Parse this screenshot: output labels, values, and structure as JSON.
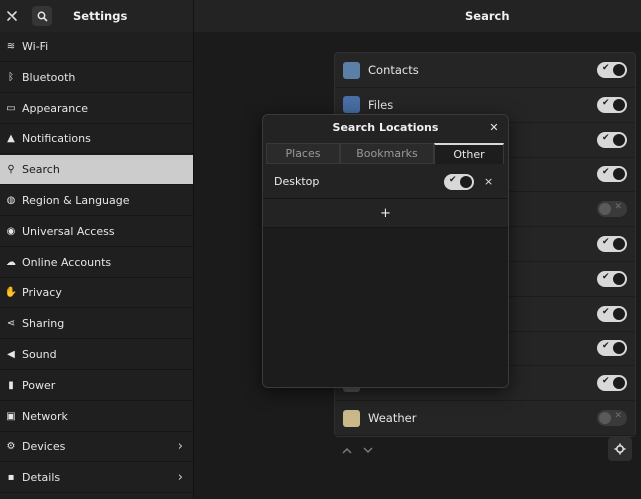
{
  "header": {
    "sidebar_title": "Settings",
    "main_title": "Search",
    "tools_icon": "tools-icon",
    "search_icon": "search-icon"
  },
  "sidebar": {
    "items": [
      {
        "label": "Wi-Fi",
        "icon": "wifi-icon",
        "glyph": "≋",
        "active": false,
        "chevron": ""
      },
      {
        "label": "Bluetooth",
        "icon": "bluetooth-icon",
        "glyph": "ᛒ",
        "active": false,
        "chevron": ""
      },
      {
        "label": "Appearance",
        "icon": "appearance-icon",
        "glyph": "▭",
        "active": false,
        "chevron": ""
      },
      {
        "label": "Notifications",
        "icon": "bell-icon",
        "glyph": "▲",
        "active": false,
        "chevron": ""
      },
      {
        "label": "Search",
        "icon": "search-icon",
        "glyph": "⚲",
        "active": true,
        "chevron": ""
      },
      {
        "label": "Region & Language",
        "icon": "globe-icon",
        "glyph": "◍",
        "active": false,
        "chevron": ""
      },
      {
        "label": "Universal Access",
        "icon": "accessibility-icon",
        "glyph": "◉",
        "active": false,
        "chevron": ""
      },
      {
        "label": "Online Accounts",
        "icon": "cloud-icon",
        "glyph": "☁",
        "active": false,
        "chevron": ""
      },
      {
        "label": "Privacy",
        "icon": "hand-icon",
        "glyph": "✋",
        "active": false,
        "chevron": ""
      },
      {
        "label": "Sharing",
        "icon": "share-icon",
        "glyph": "⋖",
        "active": false,
        "chevron": ""
      },
      {
        "label": "Sound",
        "icon": "speaker-icon",
        "glyph": "◀",
        "active": false,
        "chevron": ""
      },
      {
        "label": "Power",
        "icon": "power-icon",
        "glyph": "▮",
        "active": false,
        "chevron": ""
      },
      {
        "label": "Network",
        "icon": "network-icon",
        "glyph": "▣",
        "active": false,
        "chevron": ""
      },
      {
        "label": "Devices",
        "icon": "devices-icon",
        "glyph": "⚙",
        "active": false,
        "chevron": "›"
      },
      {
        "label": "Details",
        "icon": "info-icon",
        "glyph": "▪",
        "active": false,
        "chevron": "›"
      }
    ]
  },
  "search_list": {
    "items": [
      {
        "name": "Contacts",
        "icon": "contacts-icon",
        "color": "#5b7fa6",
        "enabled": true
      },
      {
        "name": "Files",
        "icon": "files-icon",
        "color": "#4a6fa5",
        "enabled": true
      },
      {
        "name": "",
        "icon": "app-icon",
        "color": "#555555",
        "enabled": true
      },
      {
        "name": "",
        "icon": "app-icon",
        "color": "#555555",
        "enabled": true
      },
      {
        "name": "",
        "icon": "app-icon",
        "color": "#555555",
        "enabled": false
      },
      {
        "name": "",
        "icon": "app-icon",
        "color": "#555555",
        "enabled": true
      },
      {
        "name": "",
        "icon": "app-icon",
        "color": "#555555",
        "enabled": true
      },
      {
        "name": "",
        "icon": "app-icon",
        "color": "#555555",
        "enabled": true
      },
      {
        "name": "",
        "icon": "app-icon",
        "color": "#555555",
        "enabled": true
      },
      {
        "name": "",
        "icon": "app-icon",
        "color": "#555555",
        "enabled": true
      },
      {
        "name": "Weather",
        "icon": "weather-icon",
        "color": "#c9b98a",
        "enabled": false
      }
    ],
    "move_up_icon": "chevron-up-icon",
    "move_down_icon": "chevron-down-icon",
    "settings_icon": "gear-icon"
  },
  "dialog": {
    "title": "Search Locations",
    "close_icon": "close-icon",
    "tabs": [
      {
        "label": "Places",
        "active": false
      },
      {
        "label": "Bookmarks",
        "active": false
      },
      {
        "label": "Other",
        "active": true
      }
    ],
    "location": {
      "label": "Desktop",
      "enabled": true
    },
    "add_label": "+",
    "remove_label": "×"
  },
  "colors": {
    "accent": "#cccccc",
    "background": "#1b1b1b",
    "panel": "#252525"
  }
}
